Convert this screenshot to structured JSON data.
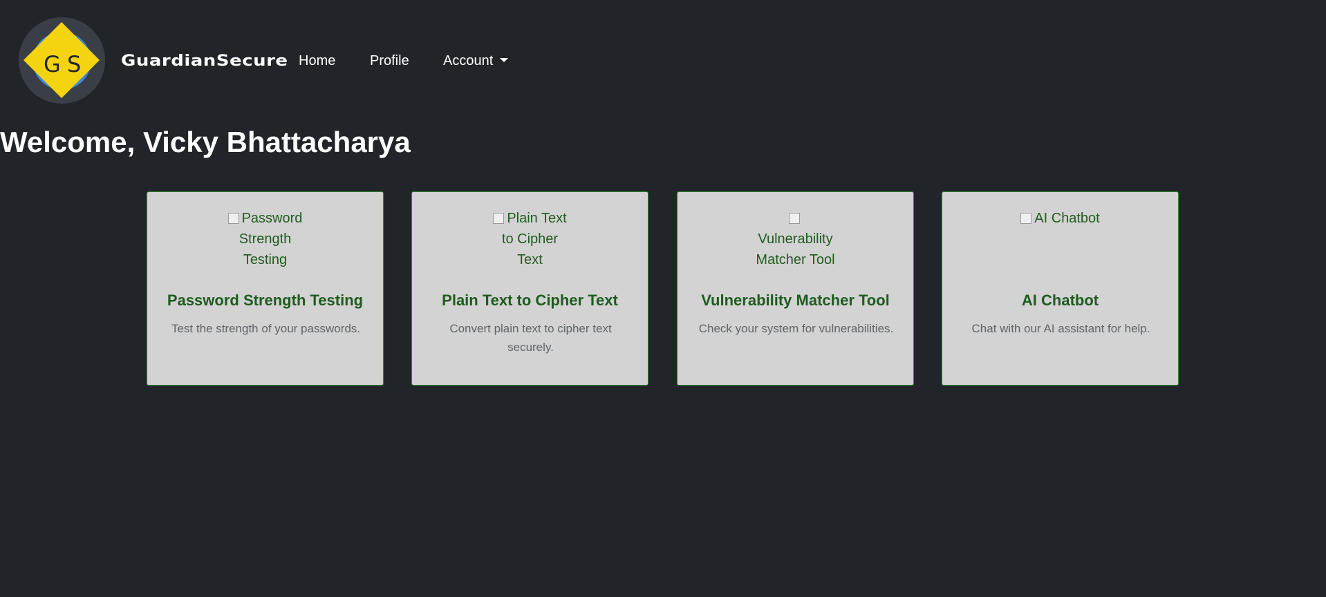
{
  "brand": {
    "logo_letters": [
      "G",
      "S"
    ],
    "name": "GuardianSecure",
    "colors": {
      "diamond": "#f4d40f",
      "circle": "#3d86db",
      "ring": "#3a3f47"
    }
  },
  "nav": {
    "home": "Home",
    "profile": "Profile",
    "account": "Account"
  },
  "welcome": "Welcome, Vicky Bhattacharya",
  "cards": [
    {
      "img_alt": "Password Strength Testing",
      "title": "Password Strength Testing",
      "text": "Test the strength of your passwords."
    },
    {
      "img_alt": "Plain Text to Cipher Text",
      "title": "Plain Text to Cipher Text",
      "text": "Convert plain text to cipher text securely."
    },
    {
      "img_alt": "Vulnerability Matcher Tool",
      "title": "Vulnerability Matcher Tool",
      "text": "Check your system for vulnerabilities."
    },
    {
      "img_alt": "AI Chatbot",
      "title": "AI Chatbot",
      "text": "Chat with our AI assistant for help."
    }
  ],
  "colors": {
    "background": "#212529",
    "card_bg": "#d3d3d3",
    "card_border": "#2e8b2e",
    "card_title": "#1e5b1e"
  }
}
